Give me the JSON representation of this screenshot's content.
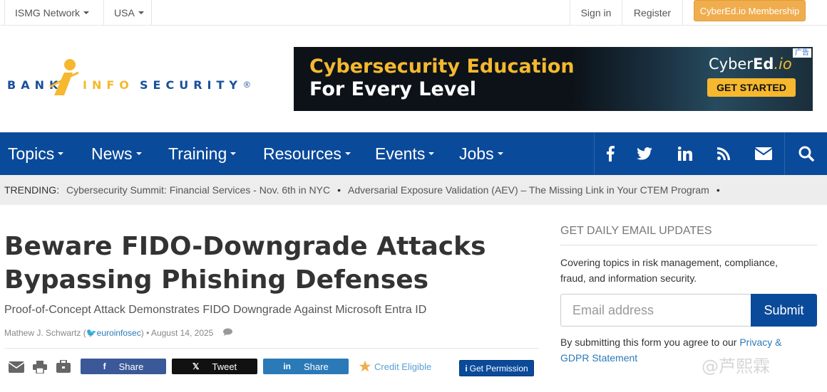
{
  "topbar": {
    "network": "ISMG Network",
    "region": "USA",
    "sign_in": "Sign in",
    "register": "Register",
    "membership": "CyberEd.io Membership"
  },
  "logo": {
    "left": "BANK",
    "middle": "INFO",
    "right": "SECURITY",
    "mark": "®"
  },
  "ad": {
    "line1": "Cybersecurity Education",
    "line2": "For Every Level",
    "brand_a": "Cyber",
    "brand_b": "Ed",
    "brand_c": ".io",
    "cta": "GET STARTED",
    "label": "广告"
  },
  "nav": {
    "items": [
      {
        "label": "Topics"
      },
      {
        "label": "News"
      },
      {
        "label": "Training"
      },
      {
        "label": "Resources"
      },
      {
        "label": "Events"
      },
      {
        "label": "Jobs"
      }
    ],
    "social_icons": [
      "facebook-icon",
      "twitter-icon",
      "linkedin-icon",
      "rss-icon",
      "envelope-icon"
    ],
    "search_icon": "search-icon"
  },
  "trending": {
    "label": "TRENDING:",
    "items": [
      "Cybersecurity Summit: Financial Services - Nov. 6th in NYC",
      "Adversarial Exposure Validation (AEV) – The Missing Link in Your CTEM Program"
    ],
    "separator": "•"
  },
  "article": {
    "title": "Beware FIDO-Downgrade Attacks Bypassing Phishing Defenses",
    "subtitle": "Proof-of-Concept Attack Demonstrates FIDO Downgrade Against Microsoft Entra ID",
    "author": "Mathew J. Schwartz",
    "handle": "euroinfosec",
    "date": "• August 14, 2025",
    "share": {
      "facebook": "Share",
      "x": "Tweet",
      "linkedin": "Share"
    },
    "credit": "Credit Eligible",
    "permission": "Get Permission",
    "colors": {
      "facebook": "#3b5998",
      "x": "#111111",
      "linkedin": "#2a7ab8"
    }
  },
  "sidebar": {
    "heading": "GET DAILY EMAIL UPDATES",
    "description": "Covering topics in risk management, compliance, fraud, and information security.",
    "email_placeholder": "Email address",
    "submit": "Submit",
    "legal_prefix": "By submitting this form you agree to our ",
    "legal_link": "Privacy & GDPR Statement"
  },
  "watermark": "@芦熙霖",
  "colors": {
    "nav_blue": "#0a4a9a",
    "membership_orange": "#f0ad4e",
    "ad_yellow": "#f5b82e"
  }
}
